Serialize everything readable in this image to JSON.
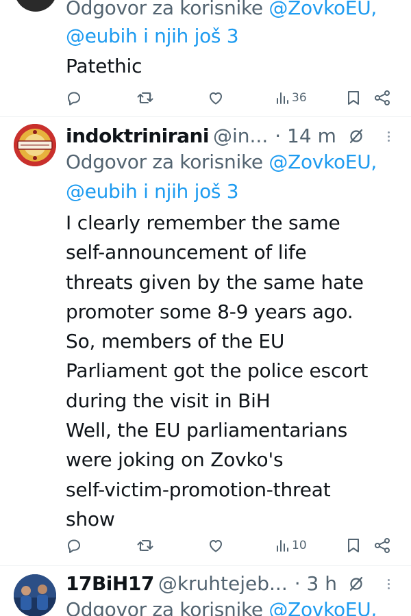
{
  "tweets": [
    {
      "reply_to": {
        "prefix": "Odgovor za korisnike ",
        "mention": "@ZovkoEU,",
        "line2": "@eubih i njih još 3"
      },
      "text_lines": [
        "Patethic"
      ],
      "actions": {
        "views": "36"
      }
    },
    {
      "author": {
        "name": "indoktrinirani",
        "handle": "@in...",
        "time": "· 14 m"
      },
      "reply_to": {
        "prefix": "Odgovor za korisnike ",
        "mention": "@ZovkoEU,",
        "line2": "@eubih i njih još 3"
      },
      "text_lines": [
        "I clearly remember the same",
        "self-announcement of life",
        "threats given by the same hate",
        "promoter some 8-9 years ago.",
        "So, members of the EU",
        "Parliament got the police escort",
        "during the visit in BiH",
        "Well, the EU parliamentarians",
        "were joking on Zovko's",
        "self-victim-promotion-threat",
        "show"
      ],
      "actions": {
        "views": "10"
      }
    },
    {
      "author": {
        "name": "17BiH17",
        "handle": "@kruhtejeb...",
        "time": "· 3 h"
      },
      "reply_to": {
        "prefix": "Odgovor za korisnike ",
        "mention": "@ZovkoEU,"
      }
    }
  ],
  "icons": {
    "reply": "reply-icon",
    "retweet": "retweet-icon",
    "like": "heart-icon",
    "views": "views-icon",
    "bookmark": "bookmark-icon",
    "share": "share-icon",
    "grok": "grok-icon",
    "more": "more-icon"
  },
  "colors": {
    "link": "#1d9bf0",
    "secondary": "#536471",
    "text": "#0f1419"
  }
}
